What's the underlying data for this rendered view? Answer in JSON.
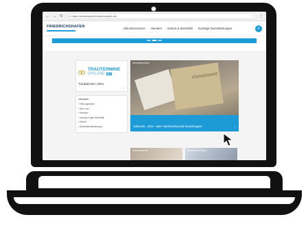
{
  "browser": {
    "url": "https://standesamt.friedrichshafen.de",
    "back_icon": "arrow-left-icon",
    "forward_icon": "arrow-right-icon",
    "reload_icon": "reload-icon"
  },
  "site": {
    "logo": "FRIEDRICHSHAFEN",
    "menu": [
      "Urkundenservice",
      "Heiraten",
      "Geburt & Sterbefall",
      "Sonstige Dienstleistungen"
    ],
    "search_icon": "search-icon"
  },
  "sidebar": {
    "trau_line1": "TRAUTERMINE",
    "trau_line2": "ONLINE",
    "trau_badge": "NEU",
    "trau_label": "Traukalender online",
    "list_title": "Übersicht",
    "list_items": [
      "Öffnungszeiten",
      "Über uns",
      "Heiraten",
      "Auszug/ Kopie Sterbefall",
      "Geburt",
      "Sterbedienstleistungen"
    ]
  },
  "feature": {
    "tag": "Urkundenservice",
    "paper_text": "STANDESAMT",
    "caption": "Geburts-, Ehe- oder Sterbeurkunde beantragen"
  },
  "tiles": [
    "Geburtenservice",
    "Sterbebeurkundung"
  ],
  "colors": {
    "accent": "#1d9bd7",
    "brand": "#1b3b6f"
  }
}
